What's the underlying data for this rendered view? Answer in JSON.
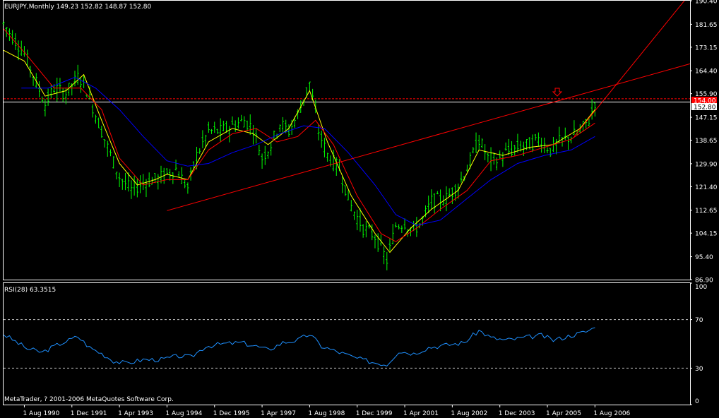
{
  "header": {
    "main_title": "EURJPY,Monthly  149.23 152.82 148.87 152.80",
    "rsi_title": "RSI(28) 63.3515",
    "copyright": "MetaTrader, ? 2001-2006 MetaQuotes Software Corp."
  },
  "price_labels": {
    "last_close": "152.80",
    "resistance": "154.00"
  },
  "colors": {
    "background": "#000000",
    "frame": "#ffffff",
    "candle": "#00ff00",
    "ma_fast": "#ffff00",
    "ma_mid": "#ff0000",
    "ma_slow": "#0000ff",
    "trendline": "#ff0000",
    "rsi_line": "#1e90ff",
    "level_line": "#ff0000",
    "rsi_levels": "#c0c0c0"
  },
  "arrow_icon": "down-arrow-icon",
  "chart_data": [
    {
      "type": "candlestick",
      "title": "EURJPY,Monthly",
      "ohlc_last": {
        "open": 149.23,
        "high": 152.82,
        "low": 148.87,
        "close": 152.8
      },
      "y_ticks": [
        "190.40",
        "181.65",
        "173.15",
        "164.40",
        "155.90",
        "147.15",
        "138.65",
        "129.90",
        "121.40",
        "112.65",
        "104.15",
        "95.40",
        "86.90"
      ],
      "ylim": [
        86.9,
        190.4
      ],
      "x_ticks": [
        "1 Aug 1990",
        "1 Dec 1991",
        "1 Apr 1993",
        "1 Aug 1994",
        "1 Dec 1995",
        "1 Apr 1997",
        "1 Aug 1998",
        "1 Dec 1999",
        "1 Apr 2001",
        "1 Aug 2002",
        "1 Dec 2003",
        "1 Apr 2005",
        "1 Aug 2006"
      ],
      "x_range": [
        "1990-01",
        "2009-04"
      ],
      "price_path": [
        {
          "d": "1990-01",
          "v": 182
        },
        {
          "d": "1990-04",
          "v": 177
        },
        {
          "d": "1990-08",
          "v": 171
        },
        {
          "d": "1990-12",
          "v": 160
        },
        {
          "d": "1991-03",
          "v": 152
        },
        {
          "d": "1991-06",
          "v": 158
        },
        {
          "d": "1991-10",
          "v": 156
        },
        {
          "d": "1992-02",
          "v": 162
        },
        {
          "d": "1992-04",
          "v": 160
        },
        {
          "d": "1992-08",
          "v": 148
        },
        {
          "d": "1992-12",
          "v": 136
        },
        {
          "d": "1993-04",
          "v": 125
        },
        {
          "d": "1993-08",
          "v": 120
        },
        {
          "d": "1993-12",
          "v": 123
        },
        {
          "d": "1994-04",
          "v": 124
        },
        {
          "d": "1994-08",
          "v": 126
        },
        {
          "d": "1994-11",
          "v": 128
        },
        {
          "d": "1995-03",
          "v": 121
        },
        {
          "d": "1995-06",
          "v": 133
        },
        {
          "d": "1995-10",
          "v": 142
        },
        {
          "d": "1996-02",
          "v": 142
        },
        {
          "d": "1996-06",
          "v": 144
        },
        {
          "d": "1996-10",
          "v": 146
        },
        {
          "d": "1997-01",
          "v": 143
        },
        {
          "d": "1997-04",
          "v": 132
        },
        {
          "d": "1997-07",
          "v": 137
        },
        {
          "d": "1997-10",
          "v": 145
        },
        {
          "d": "1998-01",
          "v": 142
        },
        {
          "d": "1998-04",
          "v": 148
        },
        {
          "d": "1998-08",
          "v": 160
        },
        {
          "d": "1998-11",
          "v": 142
        },
        {
          "d": "1999-02",
          "v": 133
        },
        {
          "d": "1999-06",
          "v": 128
        },
        {
          "d": "1999-10",
          "v": 114
        },
        {
          "d": "2000-02",
          "v": 106
        },
        {
          "d": "2000-06",
          "v": 103
        },
        {
          "d": "2000-10",
          "v": 94
        },
        {
          "d": "2001-01",
          "v": 107
        },
        {
          "d": "2001-04",
          "v": 108
        },
        {
          "d": "2001-07",
          "v": 105
        },
        {
          "d": "2001-10",
          "v": 109
        },
        {
          "d": "2002-01",
          "v": 116
        },
        {
          "d": "2002-06",
          "v": 117
        },
        {
          "d": "2002-10",
          "v": 122
        },
        {
          "d": "2003-01",
          "v": 128
        },
        {
          "d": "2003-05",
          "v": 139
        },
        {
          "d": "2003-08",
          "v": 132
        },
        {
          "d": "2003-11",
          "v": 131
        },
        {
          "d": "2004-02",
          "v": 134
        },
        {
          "d": "2004-06",
          "v": 136
        },
        {
          "d": "2004-10",
          "v": 137
        },
        {
          "d": "2005-01",
          "v": 139
        },
        {
          "d": "2005-05",
          "v": 135
        },
        {
          "d": "2005-08",
          "v": 138
        },
        {
          "d": "2005-12",
          "v": 140
        },
        {
          "d": "2006-03",
          "v": 142
        },
        {
          "d": "2006-06",
          "v": 146
        },
        {
          "d": "2006-08",
          "v": 152.8
        }
      ],
      "moving_averages": [
        {
          "color": "yellow",
          "points": [
            {
              "d": "1990-01",
              "v": 172
            },
            {
              "d": "1990-08",
              "v": 168
            },
            {
              "d": "1991-03",
              "v": 155
            },
            {
              "d": "1991-10",
              "v": 157
            },
            {
              "d": "1992-04",
              "v": 163
            },
            {
              "d": "1992-10",
              "v": 146
            },
            {
              "d": "1993-04",
              "v": 130
            },
            {
              "d": "1993-10",
              "v": 122
            },
            {
              "d": "1994-04",
              "v": 124
            },
            {
              "d": "1994-08",
              "v": 126
            },
            {
              "d": "1995-03",
              "v": 124
            },
            {
              "d": "1995-10",
              "v": 138
            },
            {
              "d": "1996-06",
              "v": 143
            },
            {
              "d": "1997-01",
              "v": 141
            },
            {
              "d": "1997-06",
              "v": 137
            },
            {
              "d": "1998-01",
              "v": 143
            },
            {
              "d": "1998-08",
              "v": 157
            },
            {
              "d": "1999-02",
              "v": 138
            },
            {
              "d": "1999-10",
              "v": 118
            },
            {
              "d": "2000-06",
              "v": 104
            },
            {
              "d": "2000-11",
              "v": 97
            },
            {
              "d": "2001-06",
              "v": 106
            },
            {
              "d": "2002-01",
              "v": 113
            },
            {
              "d": "2002-10",
              "v": 120
            },
            {
              "d": "2003-05",
              "v": 135
            },
            {
              "d": "2004-01",
              "v": 133
            },
            {
              "d": "2004-10",
              "v": 136
            },
            {
              "d": "2005-06",
              "v": 137
            },
            {
              "d": "2006-03",
              "v": 143
            },
            {
              "d": "2006-08",
              "v": 150
            }
          ]
        },
        {
          "color": "red",
          "points": [
            {
              "d": "1990-01",
              "v": 180
            },
            {
              "d": "1990-09",
              "v": 170
            },
            {
              "d": "1991-06",
              "v": 158
            },
            {
              "d": "1992-03",
              "v": 158
            },
            {
              "d": "1992-10",
              "v": 150
            },
            {
              "d": "1993-04",
              "v": 132
            },
            {
              "d": "1993-12",
              "v": 122
            },
            {
              "d": "1994-08",
              "v": 124
            },
            {
              "d": "1995-03",
              "v": 124
            },
            {
              "d": "1995-10",
              "v": 135
            },
            {
              "d": "1996-06",
              "v": 141
            },
            {
              "d": "1997-02",
              "v": 143
            },
            {
              "d": "1997-09",
              "v": 138
            },
            {
              "d": "1998-04",
              "v": 140
            },
            {
              "d": "1998-10",
              "v": 146
            },
            {
              "d": "1999-04",
              "v": 137
            },
            {
              "d": "1999-12",
              "v": 118
            },
            {
              "d": "2000-08",
              "v": 104
            },
            {
              "d": "2001-01",
              "v": 101
            },
            {
              "d": "2001-08",
              "v": 106
            },
            {
              "d": "2002-04",
              "v": 113
            },
            {
              "d": "2003-01",
              "v": 120
            },
            {
              "d": "2003-09",
              "v": 131
            },
            {
              "d": "2004-06",
              "v": 133
            },
            {
              "d": "2005-03",
              "v": 136
            },
            {
              "d": "2005-12",
              "v": 139
            },
            {
              "d": "2006-08",
              "v": 145
            }
          ]
        },
        {
          "color": "blue",
          "points": [
            {
              "d": "1990-07",
              "v": 158
            },
            {
              "d": "1991-04",
              "v": 158
            },
            {
              "d": "1992-01",
              "v": 162
            },
            {
              "d": "1992-08",
              "v": 158
            },
            {
              "d": "1993-04",
              "v": 150
            },
            {
              "d": "1993-12",
              "v": 140
            },
            {
              "d": "1994-08",
              "v": 131
            },
            {
              "d": "1995-03",
              "v": 129
            },
            {
              "d": "1995-10",
              "v": 130
            },
            {
              "d": "1996-06",
              "v": 134
            },
            {
              "d": "1997-02",
              "v": 137
            },
            {
              "d": "1997-10",
              "v": 141
            },
            {
              "d": "1998-06",
              "v": 144
            },
            {
              "d": "1999-01",
              "v": 143
            },
            {
              "d": "1999-09",
              "v": 134
            },
            {
              "d": "2000-06",
              "v": 122
            },
            {
              "d": "2001-01",
              "v": 111
            },
            {
              "d": "2001-08",
              "v": 107
            },
            {
              "d": "2002-04",
              "v": 109
            },
            {
              "d": "2003-01",
              "v": 117
            },
            {
              "d": "2003-09",
              "v": 124
            },
            {
              "d": "2004-06",
              "v": 130
            },
            {
              "d": "2005-03",
              "v": 133
            },
            {
              "d": "2005-12",
              "v": 135
            },
            {
              "d": "2006-08",
              "v": 140
            }
          ]
        }
      ],
      "trendlines": [
        {
          "from": {
            "d": "1994-08",
            "v": 112.5
          },
          "to": {
            "d": "2009-04",
            "v": 167
          }
        },
        {
          "from": {
            "d": "2006-01",
            "v": 140
          },
          "to": {
            "d": "2009-04",
            "v": 193
          }
        }
      ],
      "horizontal_levels": [
        {
          "v": 154.0,
          "style": "dashed"
        },
        {
          "v": 152.8,
          "style": "solid"
        }
      ]
    },
    {
      "type": "line",
      "title": "RSI(28) 63.3515",
      "y_ticks": [
        "100",
        "70",
        "30",
        "0"
      ],
      "ylim": [
        0,
        100
      ],
      "levels": [
        70,
        30
      ],
      "rsi_path": [
        {
          "d": "1990-01",
          "v": 58
        },
        {
          "d": "1990-05",
          "v": 52
        },
        {
          "d": "1990-09",
          "v": 46
        },
        {
          "d": "1991-02",
          "v": 43
        },
        {
          "d": "1991-07",
          "v": 49
        },
        {
          "d": "1992-02",
          "v": 56
        },
        {
          "d": "1992-06",
          "v": 47
        },
        {
          "d": "1992-10",
          "v": 42
        },
        {
          "d": "1993-02",
          "v": 36
        },
        {
          "d": "1993-06",
          "v": 34
        },
        {
          "d": "1993-12",
          "v": 37
        },
        {
          "d": "1994-06",
          "v": 37
        },
        {
          "d": "1994-12",
          "v": 40
        },
        {
          "d": "1995-04",
          "v": 39
        },
        {
          "d": "1995-09",
          "v": 48
        },
        {
          "d": "1996-03",
          "v": 50
        },
        {
          "d": "1996-09",
          "v": 51
        },
        {
          "d": "1997-02",
          "v": 48
        },
        {
          "d": "1997-06",
          "v": 45
        },
        {
          "d": "1997-11",
          "v": 51
        },
        {
          "d": "1998-04",
          "v": 53
        },
        {
          "d": "1998-08",
          "v": 58
        },
        {
          "d": "1998-12",
          "v": 48
        },
        {
          "d": "1999-06",
          "v": 43
        },
        {
          "d": "1999-12",
          "v": 38
        },
        {
          "d": "2000-05",
          "v": 35
        },
        {
          "d": "2000-10",
          "v": 33
        },
        {
          "d": "2001-02",
          "v": 44
        },
        {
          "d": "2001-07",
          "v": 42
        },
        {
          "d": "2001-12",
          "v": 47
        },
        {
          "d": "2002-06",
          "v": 49
        },
        {
          "d": "2002-12",
          "v": 51
        },
        {
          "d": "2003-05",
          "v": 61
        },
        {
          "d": "2003-09",
          "v": 55
        },
        {
          "d": "2004-02",
          "v": 53
        },
        {
          "d": "2004-08",
          "v": 55
        },
        {
          "d": "2005-02",
          "v": 57
        },
        {
          "d": "2005-06",
          "v": 53
        },
        {
          "d": "2005-12",
          "v": 57
        },
        {
          "d": "2006-05",
          "v": 60
        },
        {
          "d": "2006-08",
          "v": 63.35
        }
      ]
    }
  ]
}
